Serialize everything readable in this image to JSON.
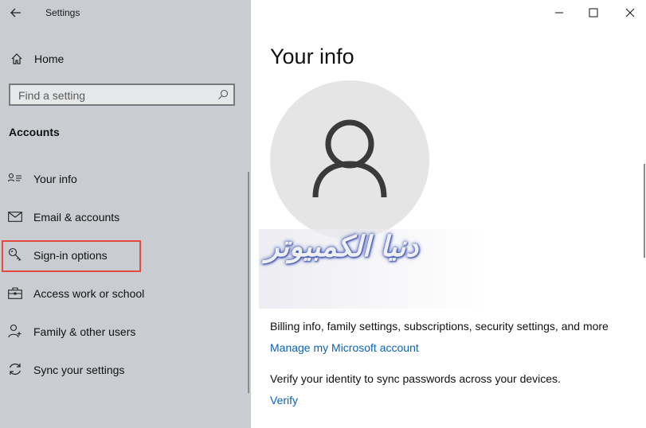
{
  "window": {
    "title": "Settings"
  },
  "sidebar": {
    "home_label": "Home",
    "search_placeholder": "Find a setting",
    "section_title": "Accounts",
    "items": [
      {
        "label": "Your info",
        "icon": "contact-card-icon"
      },
      {
        "label": "Email & accounts",
        "icon": "mail-icon"
      },
      {
        "label": "Sign-in options",
        "icon": "key-icon",
        "highlighted": true
      },
      {
        "label": "Access work or school",
        "icon": "briefcase-icon"
      },
      {
        "label": "Family & other users",
        "icon": "person-add-icon"
      },
      {
        "label": "Sync your settings",
        "icon": "sync-icon"
      }
    ]
  },
  "main": {
    "title": "Your info",
    "billing_text": "Billing info, family settings, subscriptions, security settings, and more",
    "manage_link": "Manage my Microsoft account",
    "verify_text": "Verify your identity to sync passwords across your devices.",
    "verify_link": "Verify"
  },
  "watermark": "دنيا الكمبيوتر",
  "colors": {
    "sidebar_bg": "#c9ccd1",
    "link": "#0b63b6",
    "highlight_border": "#e44a3f",
    "avatar_bg": "#e5e5e5"
  }
}
